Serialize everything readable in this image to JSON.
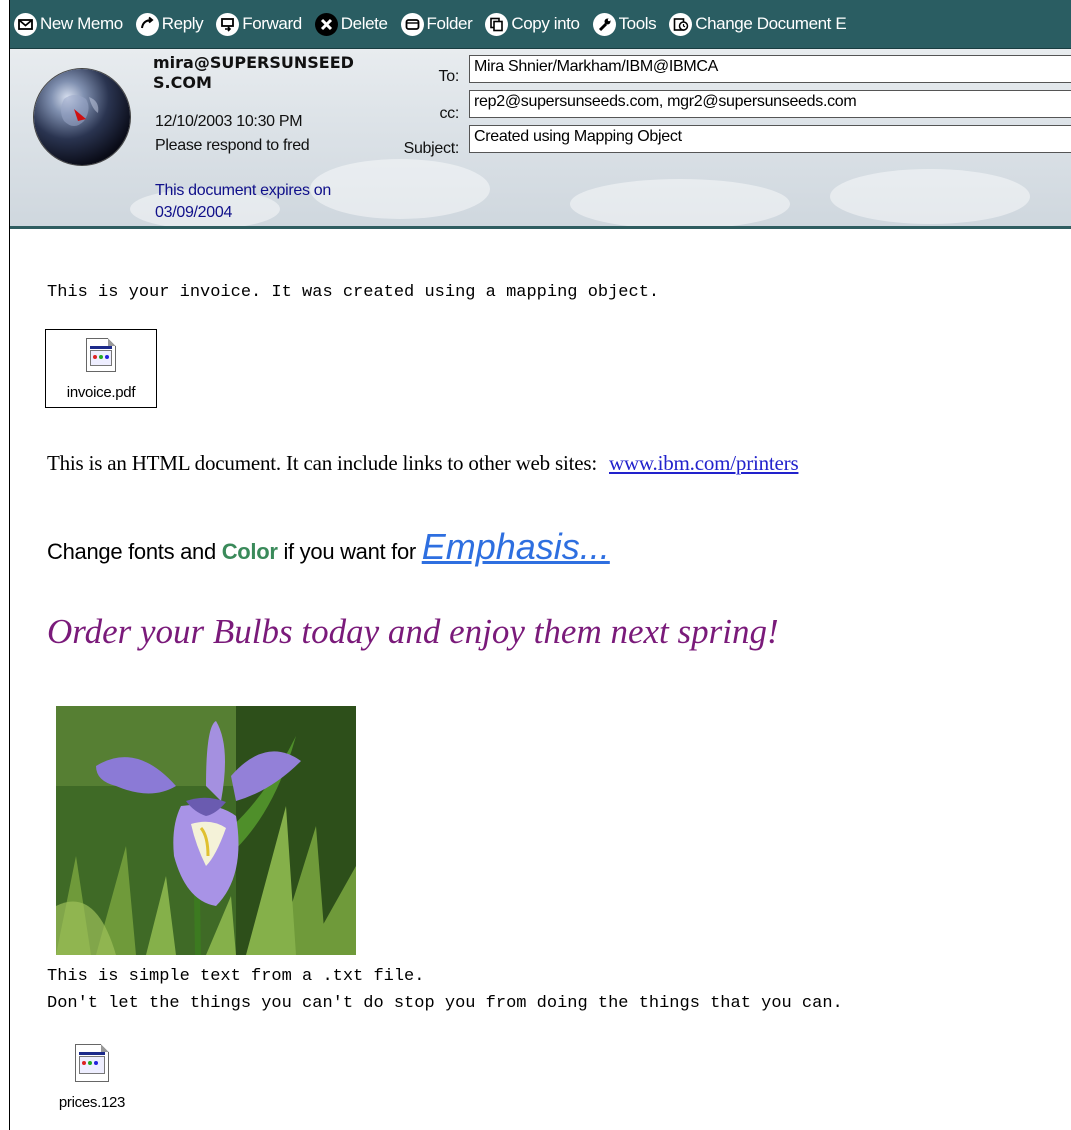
{
  "toolbar": {
    "new_memo": "New Memo",
    "reply": "Reply",
    "forward": "Forward",
    "delete": "Delete",
    "folder": "Folder",
    "copy_into": "Copy into",
    "tools": "Tools",
    "change_document": "Change Document E"
  },
  "header": {
    "sender": "mira@SUPERSUNSEEDS.COM",
    "date": "12/10/2003 10:30 PM",
    "respond": "Please respond to fred",
    "expires_line1": "This document expires on",
    "expires_line2": "03/09/2004",
    "to_label": "To:",
    "to_value": "Mira Shnier/Markham/IBM@IBMCA",
    "cc_label": "cc:",
    "cc_value": "rep2@supersunseeds.com, mgr2@supersunseeds.com",
    "subject_label": "Subject:",
    "subject_value": "Created using Mapping Object"
  },
  "body": {
    "invoice_text": "This is your invoice. It was created using a mapping object.",
    "attachment1": "invoice.pdf",
    "html_text": "This is an HTML document.  It can include links to other web sites:",
    "link_text": "www.ibm.com/printers",
    "change_prefix": "Change fonts and ",
    "color_word": "Color",
    "change_middle": " if you want for ",
    "emphasis": "Emphasis...",
    "bulbs": "Order your Bulbs today and enjoy them next spring!",
    "txt_line1": "This is simple text from a .txt file.",
    "txt_line2": "Don't let the things you can't do stop you from doing the things that you can.",
    "attachment2": "prices.123"
  },
  "colors": {
    "toolbar_bg": "#2a5d62",
    "link": "#2222cc",
    "color_word": "#3a8a5a",
    "emphasis": "#2e6fe0",
    "bulbs": "#7a1a7a",
    "expires": "#10108a"
  }
}
